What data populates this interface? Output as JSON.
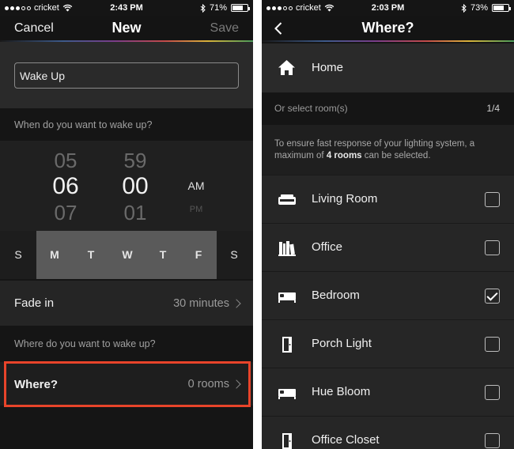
{
  "left_screen": {
    "status": {
      "carrier": "cricket",
      "time": "2:43 PM",
      "battery_percent": "71%",
      "battery_level": 0.71
    },
    "nav": {
      "cancel_label": "Cancel",
      "title": "New",
      "save_label": "Save"
    },
    "name_input": {
      "value": "Wake Up"
    },
    "wake_time_label": "When do you want to wake up?",
    "time_picker": {
      "hours": {
        "prev": "05",
        "selected": "06",
        "next": "07"
      },
      "minutes": {
        "prev": "59",
        "selected": "00",
        "next": "01"
      },
      "period": {
        "selected": "AM",
        "next": "PM"
      }
    },
    "days": [
      {
        "label": "S",
        "active": false
      },
      {
        "label": "M",
        "active": true
      },
      {
        "label": "T",
        "active": true
      },
      {
        "label": "W",
        "active": true
      },
      {
        "label": "T",
        "active": true
      },
      {
        "label": "F",
        "active": true
      },
      {
        "label": "S",
        "active": false
      }
    ],
    "fade_in": {
      "label": "Fade in",
      "value": "30 minutes"
    },
    "wake_where_label": "Where do you want to wake up?",
    "where": {
      "label": "Where?",
      "value": "0 rooms"
    },
    "highlight_color": "#e8442a"
  },
  "right_screen": {
    "status": {
      "carrier": "cricket",
      "time": "2:03 PM",
      "battery_percent": "73%",
      "battery_level": 0.73
    },
    "nav": {
      "title": "Where?"
    },
    "home_label": "Home",
    "select_rooms": {
      "label": "Or select room(s)",
      "count": "1/4"
    },
    "note": {
      "before": "To ensure fast response of your lighting system, a maximum of ",
      "bold": "4 rooms",
      "after": " can be selected."
    },
    "rooms": [
      {
        "label": "Living Room",
        "icon": "sofa-icon",
        "checked": false
      },
      {
        "label": "Office",
        "icon": "bookshelf-icon",
        "checked": false
      },
      {
        "label": "Bedroom",
        "icon": "bed-icon",
        "checked": true
      },
      {
        "label": "Porch Light",
        "icon": "door-icon",
        "checked": false
      },
      {
        "label": "Hue Bloom",
        "icon": "bed-icon",
        "checked": false
      },
      {
        "label": "Office Closet",
        "icon": "door-icon",
        "checked": false
      }
    ]
  }
}
